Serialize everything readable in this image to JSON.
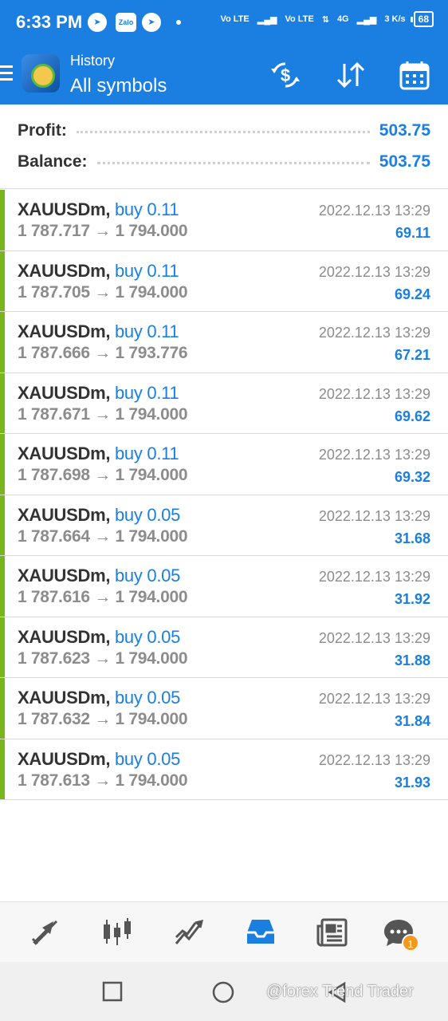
{
  "status_bar": {
    "time": "6:33 PM",
    "zalo": "Zalo",
    "network_1": "Vo LTE",
    "network_2": "Vo LTE",
    "network_gen": "4G",
    "speed": "3 K/s",
    "battery": "68"
  },
  "app_bar": {
    "subtitle": "History",
    "title": "All symbols",
    "icons": [
      "menu-icon",
      "app-logo",
      "currency-exchange-icon",
      "sort-icon",
      "calendar-icon"
    ]
  },
  "summary": {
    "profit_label": "Profit:",
    "profit_value": "503.75",
    "balance_label": "Balance:",
    "balance_value": "503.75"
  },
  "trades": [
    {
      "symbol": "XAUUSDm,",
      "side": "buy 0.11",
      "prices": "1 787.717 → 1 794.000",
      "date": "2022.12.13 13:29",
      "profit": "69.11"
    },
    {
      "symbol": "XAUUSDm,",
      "side": "buy 0.11",
      "prices": "1 787.705 → 1 794.000",
      "date": "2022.12.13 13:29",
      "profit": "69.24"
    },
    {
      "symbol": "XAUUSDm,",
      "side": "buy 0.11",
      "prices": "1 787.666 → 1 793.776",
      "date": "2022.12.13 13:29",
      "profit": "67.21"
    },
    {
      "symbol": "XAUUSDm,",
      "side": "buy 0.11",
      "prices": "1 787.671 → 1 794.000",
      "date": "2022.12.13 13:29",
      "profit": "69.62"
    },
    {
      "symbol": "XAUUSDm,",
      "side": "buy 0.11",
      "prices": "1 787.698 → 1 794.000",
      "date": "2022.12.13 13:29",
      "profit": "69.32"
    },
    {
      "symbol": "XAUUSDm,",
      "side": "buy 0.05",
      "prices": "1 787.664 → 1 794.000",
      "date": "2022.12.13 13:29",
      "profit": "31.68"
    },
    {
      "symbol": "XAUUSDm,",
      "side": "buy 0.05",
      "prices": "1 787.616 → 1 794.000",
      "date": "2022.12.13 13:29",
      "profit": "31.92"
    },
    {
      "symbol": "XAUUSDm,",
      "side": "buy 0.05",
      "prices": "1 787.623 → 1 794.000",
      "date": "2022.12.13 13:29",
      "profit": "31.88"
    },
    {
      "symbol": "XAUUSDm,",
      "side": "buy 0.05",
      "prices": "1 787.632 → 1 794.000",
      "date": "2022.12.13 13:29",
      "profit": "31.84"
    },
    {
      "symbol": "XAUUSDm,",
      "side": "buy 0.05",
      "prices": "1 787.613 → 1 794.000",
      "date": "2022.12.13 13:29",
      "profit": "31.93"
    }
  ],
  "bottom_nav": {
    "items": [
      "quotes-icon",
      "chart-icon",
      "trade-icon",
      "history-icon",
      "news-icon",
      "chat-icon"
    ],
    "active": "history-icon",
    "chat_badge": "1"
  },
  "system_nav": {
    "watermark": "@forex Trend Trader"
  },
  "colors": {
    "accent": "#1a7fe0",
    "buy_bar": "#79b51c",
    "badge": "#f39a1e"
  }
}
